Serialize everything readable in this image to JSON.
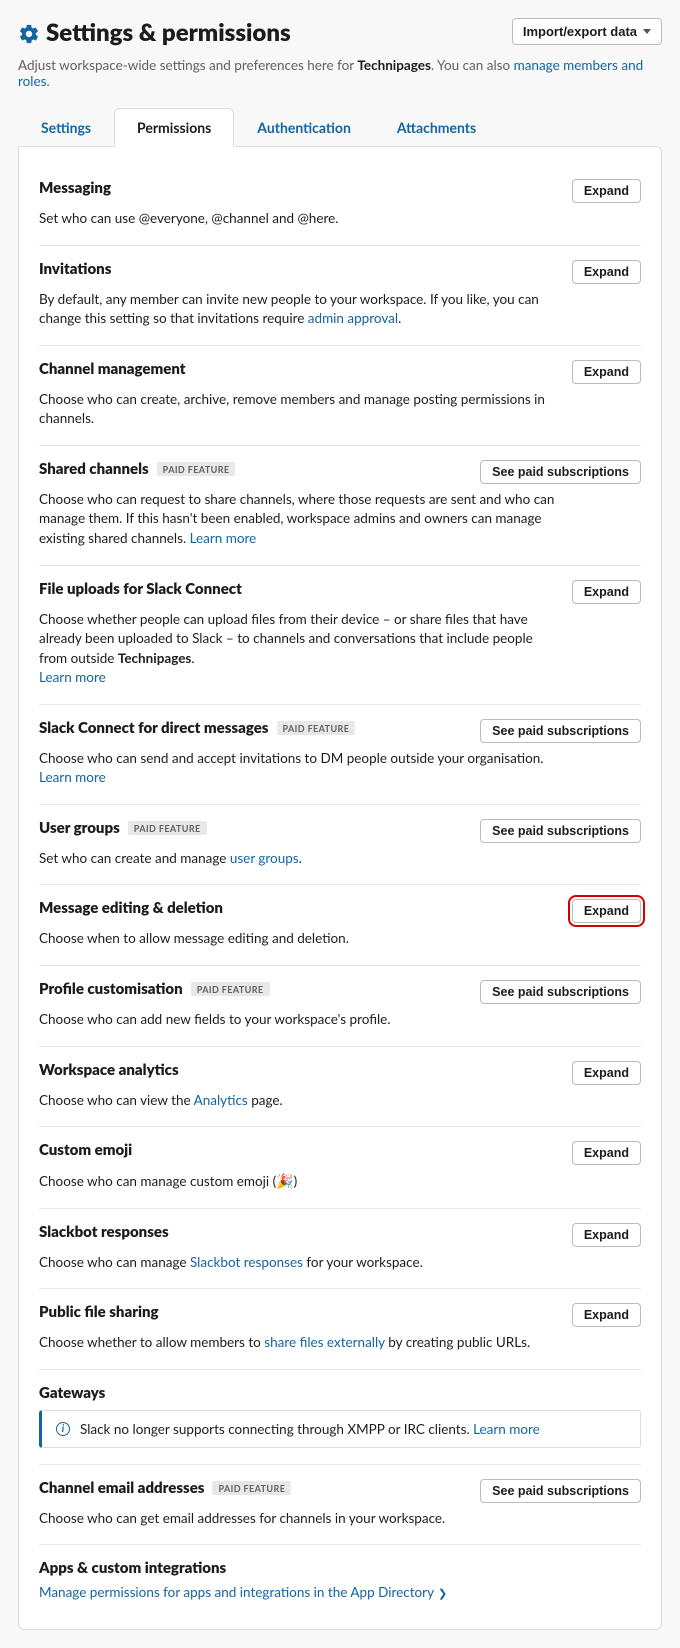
{
  "header": {
    "title": "Settings & permissions",
    "import_label": "Import/export data"
  },
  "subtext": {
    "before": "Adjust workspace-wide settings and preferences here for ",
    "workspace": "Technipages",
    "after": ". You can also ",
    "link": "manage members and roles",
    "period": "."
  },
  "tabs": {
    "settings": "Settings",
    "permissions": "Permissions",
    "authentication": "Authentication",
    "attachments": "Attachments"
  },
  "badges": {
    "paid": "PAID FEATURE"
  },
  "actions": {
    "expand": "Expand",
    "paid": "See paid subscriptions"
  },
  "sections": {
    "messaging": {
      "title": "Messaging",
      "desc": "Set who can use @everyone, @channel and @here."
    },
    "invitations": {
      "title": "Invitations",
      "desc_before": "By default, any member can invite new people to your workspace. If you like, you can change this setting so that invitations require ",
      "desc_link": "admin approval",
      "desc_after": "."
    },
    "channel_mgmt": {
      "title": "Channel management",
      "desc": "Choose who can create, archive, remove members and manage posting permissions in channels."
    },
    "shared_channels": {
      "title": "Shared channels",
      "desc": "Choose who can request to share channels, where those requests are sent and who can manage them. If this hasn't been enabled, workspace admins and owners can manage existing shared channels. ",
      "learn_more": "Learn more"
    },
    "file_uploads": {
      "title": "File uploads for Slack Connect",
      "desc_before": "Choose whether people can upload files from their device – or share files that have already been uploaded to Slack – to channels and conversations that include people from outside ",
      "workspace": "Technipages",
      "desc_after": ". ",
      "learn_more": "Learn more"
    },
    "slack_connect_dm": {
      "title": "Slack Connect for direct messages",
      "desc": "Choose who can send and accept invitations to DM people outside your organisation. ",
      "learn_more": "Learn more"
    },
    "user_groups": {
      "title": "User groups",
      "desc_before": "Set who can create and manage ",
      "desc_link": "user groups",
      "desc_after": "."
    },
    "msg_edit": {
      "title": "Message editing & deletion",
      "desc": "Choose when to allow message editing and deletion."
    },
    "profile_custom": {
      "title": "Profile customisation",
      "desc": "Choose who can add new fields to your workspace's profile."
    },
    "analytics": {
      "title": "Workspace analytics",
      "desc_before": "Choose who can view the ",
      "desc_link": "Analytics",
      "desc_after": " page."
    },
    "custom_emoji": {
      "title": "Custom emoji",
      "desc_before": "Choose who can manage custom emoji (",
      "desc_after": ")"
    },
    "slackbot": {
      "title": "Slackbot responses",
      "desc_before": "Choose who can manage ",
      "desc_link": "Slackbot responses",
      "desc_after": " for your workspace."
    },
    "public_file": {
      "title": "Public file sharing",
      "desc_before": "Choose whether to allow members to ",
      "desc_link": "share files externally",
      "desc_after": " by creating public URLs."
    },
    "gateways": {
      "title": "Gateways",
      "info": "Slack no longer supports connecting through XMPP or IRC clients. ",
      "learn_more": "Learn more"
    },
    "channel_email": {
      "title": "Channel email addresses",
      "desc": "Choose who can get email addresses for channels in your workspace."
    },
    "apps": {
      "title": "Apps & custom integrations",
      "link": "Manage permissions for apps and integrations in the App Directory"
    }
  }
}
